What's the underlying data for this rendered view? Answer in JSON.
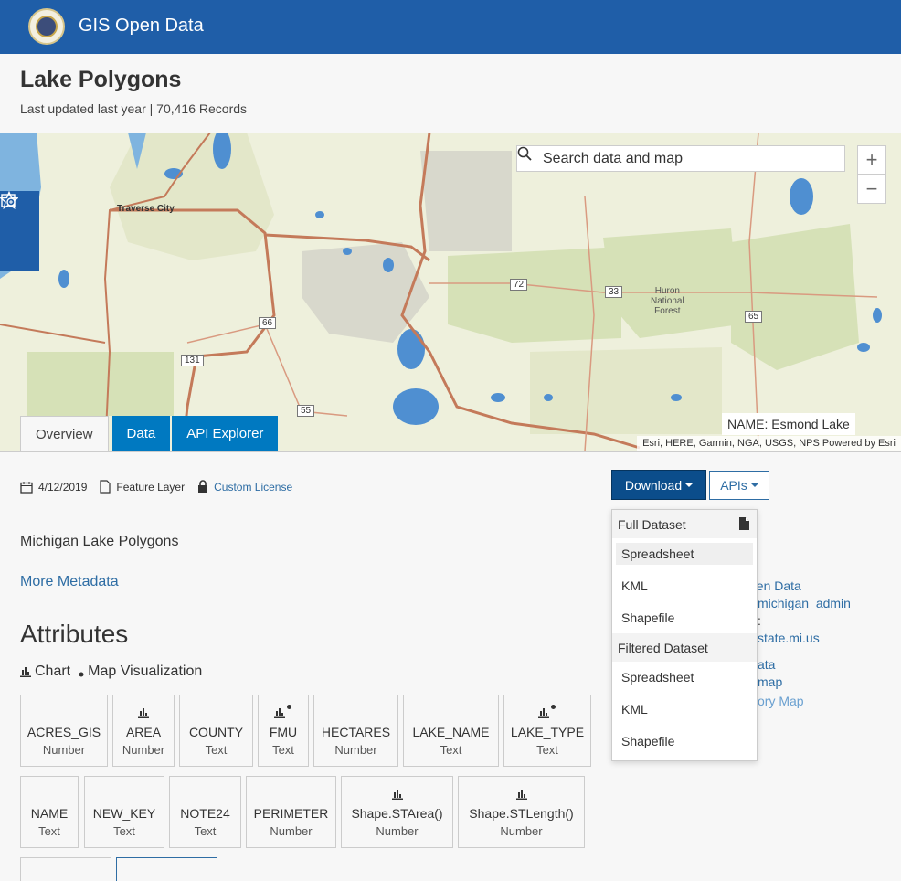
{
  "header": {
    "site_title": "GIS Open Data"
  },
  "dataset": {
    "title": "Lake Polygons",
    "subtitle": "Last updated last year | 70,416 Records",
    "date": "4/12/2019",
    "type": "Feature Layer",
    "license": "Custom License",
    "description": "Michigan Lake Polygons",
    "more_metadata": "More Metadata"
  },
  "map": {
    "search_placeholder": "Search data and map",
    "zoom_in": "+",
    "zoom_out": "−",
    "labels": {
      "traverse_city": "Traverse City",
      "forest": "Huron\nNational\nForest",
      "r72": "72",
      "r33": "33",
      "r66": "66",
      "r131": "131",
      "r55": "55",
      "r65": "65"
    },
    "popup": "NAME: Esmond Lake",
    "attribution": "Esri, HERE, Garmin, NGA, USGS, NPS   Powered by Esri"
  },
  "tabs": [
    "Overview",
    "Data",
    "API Explorer"
  ],
  "actions": {
    "download": "Download",
    "apis": "APIs"
  },
  "download_menu": {
    "full_header": "Full Dataset",
    "full_items": [
      "Spreadsheet",
      "KML",
      "Shapefile"
    ],
    "filtered_header": "Filtered Dataset",
    "filtered_items": [
      "Spreadsheet",
      "KML",
      "Shapefile"
    ]
  },
  "side_info": {
    "line1": "pen Data",
    "line2": "michigan_admin",
    "line3": ":",
    "line4": "state.mi.us",
    "line5": "ata",
    "line6": "map",
    "line7": "ory Map"
  },
  "attributes": {
    "heading": "Attributes",
    "viz_chart": "Chart",
    "viz_map": "Map Visualization",
    "fields": [
      {
        "name": "ACRES_GIS",
        "type": "Number"
      },
      {
        "name": "AREA",
        "type": "Number"
      },
      {
        "name": "COUNTY",
        "type": "Text"
      },
      {
        "name": "FMU",
        "type": "Text"
      },
      {
        "name": "HECTARES",
        "type": "Number"
      },
      {
        "name": "LAKE_NAME",
        "type": "Text"
      },
      {
        "name": "LAKE_TYPE",
        "type": "Text"
      },
      {
        "name": "NAME",
        "type": "Text"
      },
      {
        "name": "NEW_KEY",
        "type": "Text"
      },
      {
        "name": "NOTE24",
        "type": "Text"
      },
      {
        "name": "PERIMETER",
        "type": "Number"
      },
      {
        "name": "Shape.STArea()",
        "type": "Number"
      },
      {
        "name": "Shape.STLength()",
        "type": "Number"
      }
    ]
  },
  "colors": {
    "brand": "#1f5ea8",
    "link": "#2e6da4",
    "button": "#0b4d8b"
  }
}
